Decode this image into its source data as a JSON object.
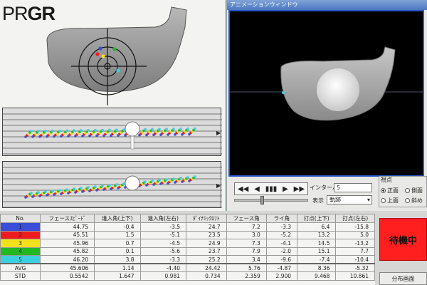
{
  "brand": {
    "prefix": "PR",
    "bold": "GR"
  },
  "animation_window": {
    "title": "アニメーションウィンドウ"
  },
  "controls": {
    "playback_icons": [
      "◀◀",
      "◀",
      "▮▮▮",
      "▶",
      "▶▶"
    ],
    "interval_label": "インターバル",
    "interval_value": "5",
    "display_label": "表示",
    "display_value": "軌跡",
    "viewpoint_label": "視点",
    "viewpoints": [
      {
        "label": "正面",
        "selected": true
      },
      {
        "label": "側面",
        "selected": false
      },
      {
        "label": "上面",
        "selected": false
      },
      {
        "label": "斜め",
        "selected": false
      }
    ]
  },
  "table": {
    "headers": [
      "No.",
      "フェースｽﾋﾟｰﾄﾞ",
      "進入角(上下)",
      "進入角(左右)",
      "ﾀﾞｲﾅﾐｯｸﾛﾌﾄ",
      "フェース角",
      "ライ角",
      "打点(上下)",
      "打点(左右)"
    ],
    "rows": [
      {
        "no": "1",
        "color": "#3a4ed8",
        "values": [
          "44.75",
          "-0.4",
          "-3.5",
          "24.7",
          "7.2",
          "-3.3",
          "6.4",
          "-15.8"
        ]
      },
      {
        "no": "2",
        "color": "#ee1c1c",
        "values": [
          "45.51",
          "1.5",
          "-5.1",
          "23.5",
          "3.0",
          "-5.2",
          "13.2",
          "5.0"
        ]
      },
      {
        "no": "3",
        "color": "#f2e21a",
        "values": [
          "45.96",
          "0.7",
          "-4.5",
          "24.9",
          "7.3",
          "-4.1",
          "14.5",
          "-13.2"
        ]
      },
      {
        "no": "4",
        "color": "#22b822",
        "values": [
          "45.82",
          "0.1",
          "-5.6",
          "23.7",
          "7.9",
          "-2.0",
          "15.1",
          "7.7"
        ]
      },
      {
        "no": "5",
        "color": "#3bd0e0",
        "values": [
          "46.20",
          "3.8",
          "-3.3",
          "25.2",
          "3.4",
          "-9.6",
          "-7.4",
          "-10.4"
        ]
      }
    ],
    "avg": {
      "label": "AVG",
      "values": [
        "45.606",
        "1.14",
        "-4.40",
        "24.42",
        "5.76",
        "-4.87",
        "8.36",
        "-5.32"
      ]
    },
    "std": {
      "label": "STD",
      "values": [
        "0.5542",
        "1.647",
        "0.981",
        "0.734",
        "2.359",
        "2.900",
        "9.468",
        "10.861"
      ]
    }
  },
  "status": {
    "label": "待機中",
    "color": "#ff1f1f"
  },
  "distribution_button": {
    "label": "分布画面"
  },
  "impact_dots": [
    {
      "color": "#3a4ed8"
    },
    {
      "color": "#ee1c1c"
    },
    {
      "color": "#f2e21a"
    },
    {
      "color": "#22b822"
    },
    {
      "color": "#3bd0e0"
    }
  ]
}
